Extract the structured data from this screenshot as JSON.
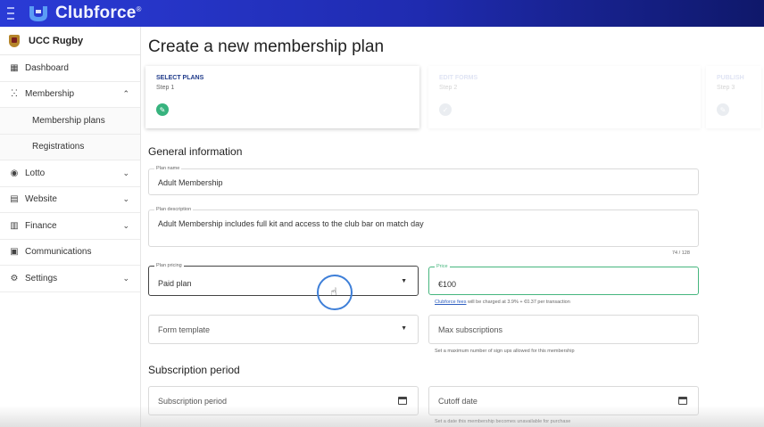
{
  "app": {
    "brand": "Clubforce",
    "reg": "®"
  },
  "sidebar": {
    "club_name": "UCC Rugby",
    "items": [
      {
        "label": "Dashboard",
        "icon": "grid-icon"
      },
      {
        "label": "Membership",
        "icon": "people-icon",
        "chevron": "^"
      },
      {
        "label": "Membership plans",
        "sub": true
      },
      {
        "label": "Registrations",
        "sub": true
      },
      {
        "label": "Lotto",
        "icon": "lotto-icon",
        "chevron": "v"
      },
      {
        "label": "Website",
        "icon": "website-icon",
        "chevron": "v"
      },
      {
        "label": "Finance",
        "icon": "finance-icon",
        "chevron": "v"
      },
      {
        "label": "Communications",
        "icon": "communications-icon"
      },
      {
        "label": "Settings",
        "icon": "settings-icon",
        "chevron": "v"
      }
    ]
  },
  "page": {
    "title": "Create a new membership plan"
  },
  "steps": [
    {
      "title": "SELECT PLANS",
      "sub": "Step 1",
      "state": "active"
    },
    {
      "title": "EDIT FORMS",
      "sub": "Step 2",
      "state": "pending"
    },
    {
      "title": "PUBLISH",
      "sub": "Step 3",
      "state": "pending"
    }
  ],
  "general": {
    "heading": "General information",
    "plan_name": {
      "label": "Plan name",
      "value": "Adult Membership"
    },
    "plan_description": {
      "label": "Plan description",
      "value": "Adult Membership includes full kit and access to the club bar on match day",
      "counter": "74 / 128"
    },
    "plan_pricing": {
      "label": "Plan pricing",
      "value": "Paid plan"
    },
    "price": {
      "label": "Price",
      "value": "€100"
    },
    "price_hint": {
      "link": "Clubforce fees",
      "text": " will be charged at 3.9% + €0.37 per transaction"
    },
    "form_template": {
      "placeholder": "Form template"
    },
    "max_subscriptions": {
      "placeholder": "Max subscriptions",
      "hint": "Set a maximum number of sign ups allowed for this membership"
    }
  },
  "subscription": {
    "heading": "Subscription period",
    "period": {
      "placeholder": "Subscription period"
    },
    "cutoff": {
      "placeholder": "Cutoff date",
      "hint": "Set a date this membership becomes unavailable for purchase"
    }
  },
  "colors": {
    "accent": "#2a3bd6",
    "success": "#37b37e",
    "focus": "#46b67e",
    "link": "#2f5fc0"
  }
}
